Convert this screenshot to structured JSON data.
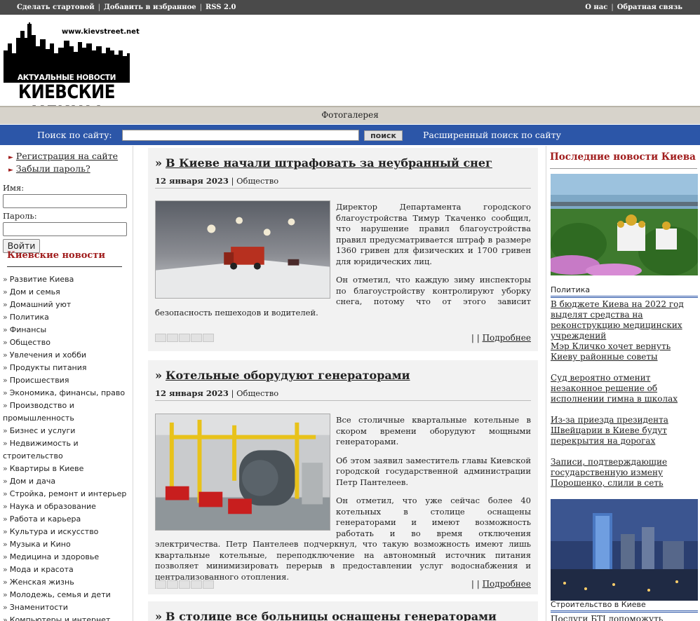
{
  "topbar": {
    "left_links": [
      "Сделать стартовой",
      "Добавить в избранное",
      "RSS 2.0"
    ],
    "right_links": [
      "О нас",
      "Обратная связь"
    ]
  },
  "logo": {
    "url": "www.kievstreet.net",
    "tagline": "АКТУАЛЬНЫЕ НОВОСТИ КИЕВА",
    "name": "КИЕВСКИЕ УЛИЦЫ"
  },
  "nav": {
    "gallery": "Фотогалерея"
  },
  "search": {
    "label": "Поиск по сайту:",
    "button": "поиск",
    "advanced": "Расширенный поиск по сайту",
    "value": ""
  },
  "auth": {
    "register": "Регистрация на сайте",
    "forgot": "Забыли пароль?",
    "name_label": "Имя:",
    "password_label": "Пароль:",
    "login_button": "Войти"
  },
  "categories": {
    "title": "Киевские новости",
    "items": [
      "Развитие Киева",
      "Дом и семья",
      "Домашний уют",
      "Политика",
      "Финансы",
      "Общество",
      "Увлечения и хобби",
      "Продукты питания",
      "Происшествия",
      "Экономика, финансы, право",
      "Производство и промышленность",
      "Бизнес и услуги",
      "Недвижимость и строительство",
      "Квартиры в Киеве",
      "Дом и дача",
      "Стройка, ремонт и интерьер",
      "Наука и образование",
      "Работа и карьера",
      "Культура и искусство",
      "Музыка и Кино",
      "Медицина и здоровье",
      "Мода и красота",
      "Женская жизнь",
      "Молодежь, семья и дети",
      "Знаменитости",
      "Компьютеры и интернет"
    ]
  },
  "articles": [
    {
      "title": "В Киеве начали штрафовать за неубранный снег",
      "date": "12 января 2023",
      "category": "Общество",
      "paragraphs": [
        "Директор Департамента городского благоустройства Тимур Ткаченко сообщил, что нарушение правил благоустройства правил предусматривается штраф в размере 1360 гривен для физических и 1700 гривен для юридических лиц.",
        "Он отметил, что каждую зиму инспекторы по благоустройству контролируют уборку снега, потому что от этого зависит безопасность пешеходов и водителей."
      ],
      "more": "Подробнее",
      "more_sep": "| |",
      "image": "snow-plow-night"
    },
    {
      "title": "Котельные оборудуют генераторами",
      "date": "12 января 2023",
      "category": "Общество",
      "paragraphs": [
        "Все столичные квартальные котельные в скором времени оборудуют мощными генераторами.",
        "Об этом заявил заместитель главы Киевской городской государственной администрации Петр Пантелеев.",
        "Он отметил, что уже сейчас более 40 котельных в столице оснащены генераторами и имеют возможность работать и во время отключения электричества. Петр Пантелеев подчеркнул, что такую возможность имеют лишь квартальные котельные, переподключение на автономный источник питания позволяет минимизировать перерыв в предоставлении услуг водоснабжения и централизованного отопления."
      ],
      "more": "Подробнее",
      "more_sep": "| |",
      "image": "boiler-room"
    },
    {
      "title": "В столице все больницы оснащены генераторами"
    }
  ],
  "right": {
    "title": "Последние новости Киева",
    "photo1_caption": "Политика",
    "links": [
      "В бюджете Киева на 2022 год выделят средства на реконструкцию медицинских учреждений",
      "Мэр Кличко хочет вернуть Киеву районные советы",
      "Суд вероятно отменит незаконное решение об исполнении гимна в школах",
      "Из-за приезда президента Швейцарии в Киеве будут перекрытия на дорогах",
      "Записи, подтверждающие государственную измену Порошенко, слили в сеть"
    ],
    "photo2_caption": "Строительство в Киеве",
    "last_link": "Послуги БТІ допоможуть вирішити"
  },
  "colors": {
    "accent_red": "#a01c1c",
    "search_blue": "#2c56a8",
    "topbar": "#4a4a4a",
    "gallery_bar": "#d7d3cb"
  }
}
